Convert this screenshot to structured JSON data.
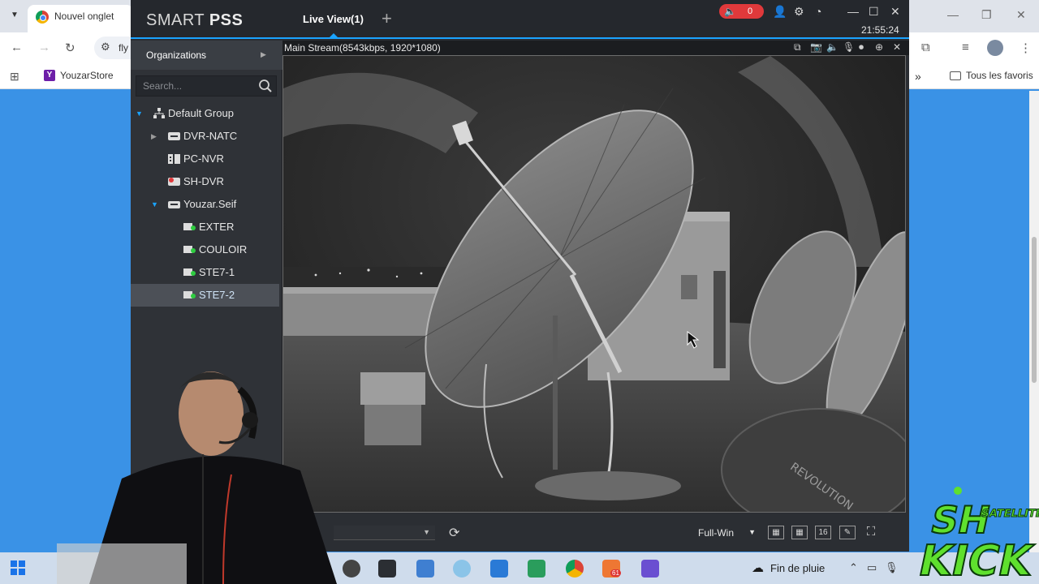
{
  "browser": {
    "tab_title": "Nouvel onglet",
    "omnibox_text": "fly",
    "bookmarks": [
      {
        "label": "YouzarStore"
      }
    ],
    "all_bookmarks_label": "Tous les favoris"
  },
  "app": {
    "logo_prefix": "SMART",
    "logo_suffix": "PSS",
    "tab_label": "Live View(1)",
    "alarm_count": "0",
    "clock": "21:55:24"
  },
  "sidebar": {
    "organizations_label": "Organizations",
    "search_placeholder": "Search...",
    "tree": [
      {
        "label": "Default Group"
      },
      {
        "label": "DVR-NATC"
      },
      {
        "label": "PC-NVR"
      },
      {
        "label": "SH-DVR"
      },
      {
        "label": "Youzar.Seif"
      },
      {
        "label": "EXTER"
      },
      {
        "label": "COULOIR"
      },
      {
        "label": "STE7-1"
      },
      {
        "label": "STE7-2"
      }
    ]
  },
  "video": {
    "stream_info": "Main Stream(8543kbps, 1920*1080)"
  },
  "bottom_bar": {
    "window_mode": "Full-Win",
    "layout_16_label": "16"
  },
  "taskbar": {
    "weather_text": "Fin de pluie",
    "badge_count": "61"
  },
  "colors": {
    "accent": "#1aa3ff",
    "alarm": "#e0393b",
    "desktop": "#3a92e6"
  }
}
